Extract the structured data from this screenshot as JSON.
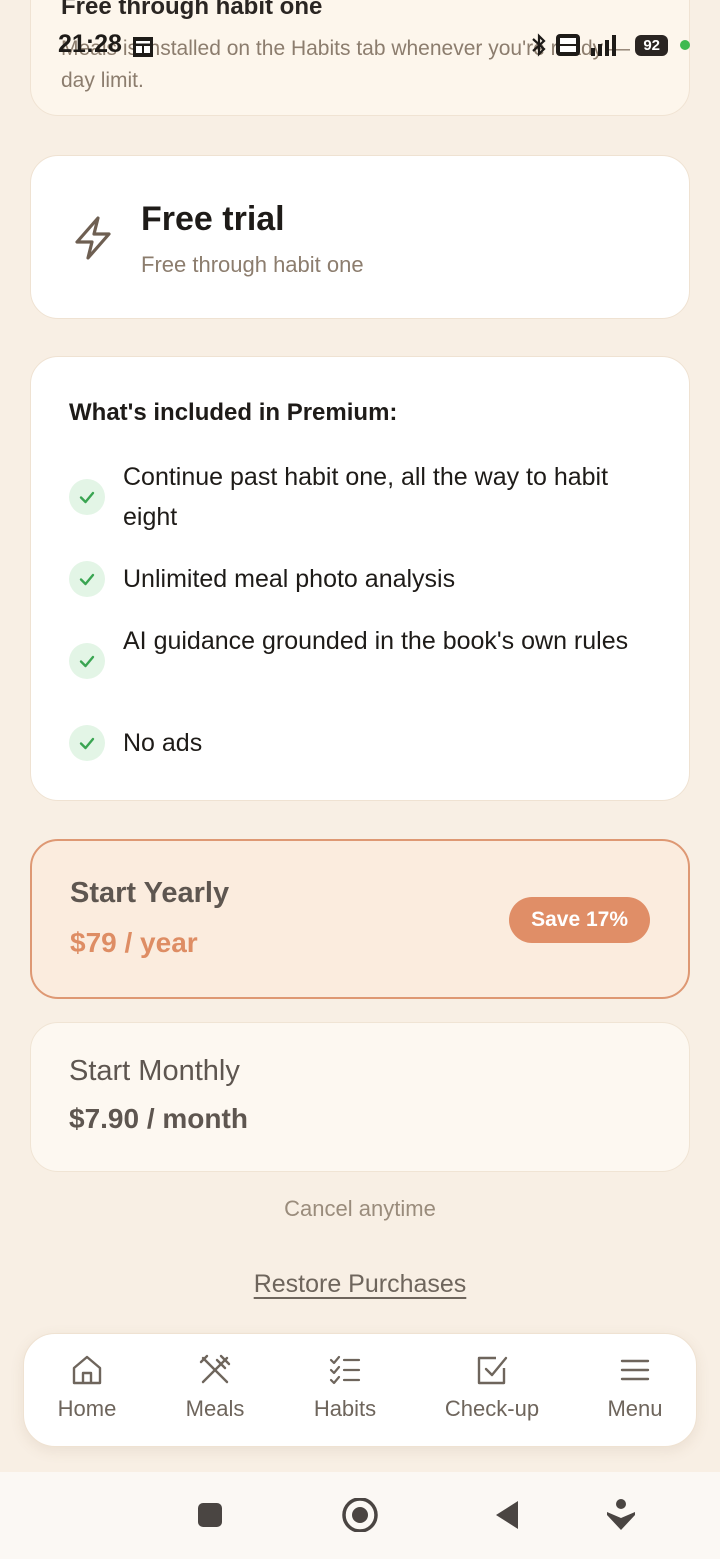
{
  "status_bar": {
    "time": "21:28",
    "battery": "92"
  },
  "top_card": {
    "title": "Free through habit one",
    "description": "Meals is installed on the Habits tab whenever you're ready — no day limit."
  },
  "trial_card": {
    "title": "Free trial",
    "subtitle": "Free through habit one"
  },
  "features": {
    "title": "What's included in Premium:",
    "items": [
      "Continue past habit one, all the way to habit eight",
      "Unlimited meal photo analysis",
      "AI guidance grounded in the book's own rules",
      "No ads"
    ]
  },
  "plans": {
    "yearly": {
      "name": "Start Yearly",
      "price": "$79 / year",
      "badge": "Save 17%"
    },
    "monthly": {
      "name": "Start Monthly",
      "price": "$7.90 / month"
    }
  },
  "cancel_text": "Cancel anytime",
  "restore_label": "Restore Purchases",
  "bottom_nav": [
    {
      "label": "Home",
      "icon": "home-icon"
    },
    {
      "label": "Meals",
      "icon": "utensils-icon"
    },
    {
      "label": "Habits",
      "icon": "checklist-icon"
    },
    {
      "label": "Check-up",
      "icon": "check-square-icon"
    },
    {
      "label": "Menu",
      "icon": "menu-icon"
    }
  ],
  "colors": {
    "background": "#f8efe4",
    "accent": "#de8d64",
    "check_green": "#3aa552",
    "check_bg": "#e3f5e6"
  }
}
